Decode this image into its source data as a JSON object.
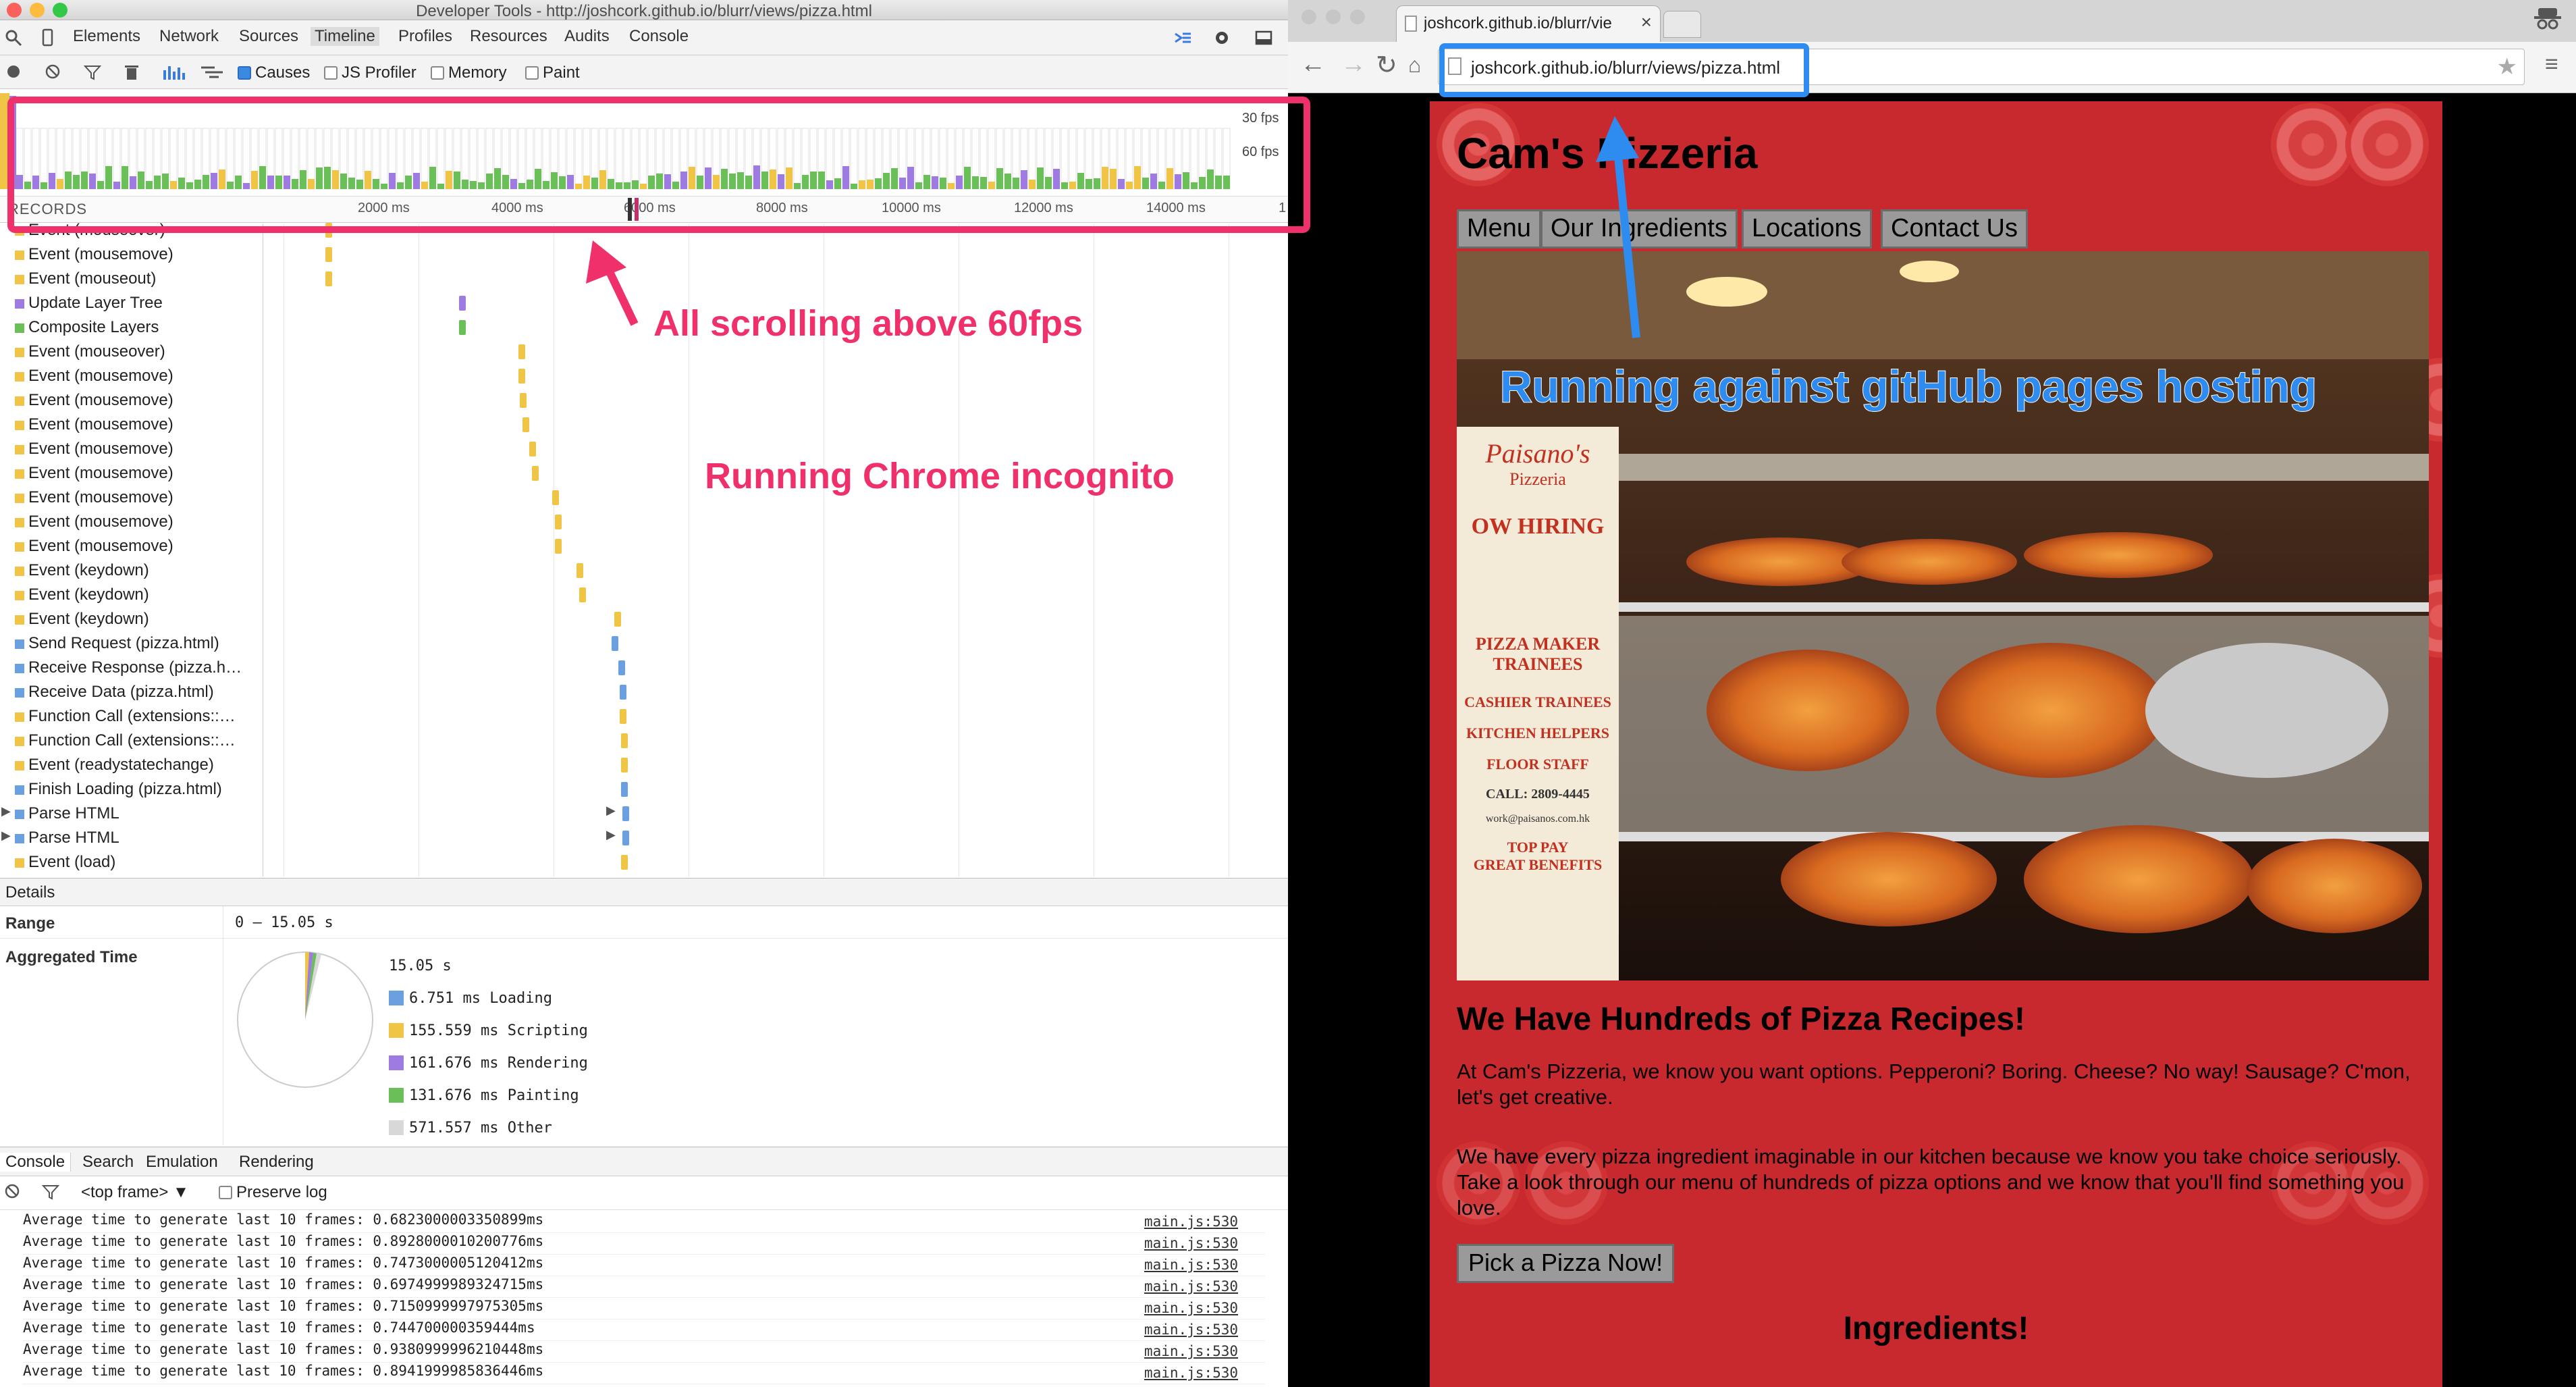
{
  "devtools": {
    "window_title": "Developer Tools - http://joshcork.github.io/blurr/views/pizza.html",
    "tabs": [
      "Elements",
      "Network",
      "Sources",
      "Timeline",
      "Profiles",
      "Resources",
      "Audits",
      "Console"
    ],
    "active_tab": "Timeline",
    "toolbar": {
      "causes": "Causes",
      "js_profiler": "JS Profiler",
      "memory": "Memory",
      "paint": "Paint"
    },
    "fps_30": "30 fps",
    "fps_60": "60 fps",
    "records_label": "RECORDS",
    "axis_ticks": [
      "2000 ms",
      "4000 ms",
      "6000 ms",
      "8000 ms",
      "10000 ms",
      "12000 ms",
      "14000 ms",
      "1"
    ],
    "records": [
      {
        "label": "Event (mouseover)",
        "color": "#f0c444",
        "expandable": false
      },
      {
        "label": "Event (mousemove)",
        "color": "#f0c444",
        "expandable": false
      },
      {
        "label": "Event (mouseout)",
        "color": "#f0c444",
        "expandable": false
      },
      {
        "label": "Update Layer Tree",
        "color": "#9e7be0",
        "expandable": false
      },
      {
        "label": "Composite Layers",
        "color": "#6bbf59",
        "expandable": false
      },
      {
        "label": "Event (mouseover)",
        "color": "#f0c444",
        "expandable": false
      },
      {
        "label": "Event (mousemove)",
        "color": "#f0c444",
        "expandable": false
      },
      {
        "label": "Event (mousemove)",
        "color": "#f0c444",
        "expandable": false
      },
      {
        "label": "Event (mousemove)",
        "color": "#f0c444",
        "expandable": false
      },
      {
        "label": "Event (mousemove)",
        "color": "#f0c444",
        "expandable": false
      },
      {
        "label": "Event (mousemove)",
        "color": "#f0c444",
        "expandable": false
      },
      {
        "label": "Event (mousemove)",
        "color": "#f0c444",
        "expandable": false
      },
      {
        "label": "Event (mousemove)",
        "color": "#f0c444",
        "expandable": false
      },
      {
        "label": "Event (mousemove)",
        "color": "#f0c444",
        "expandable": false
      },
      {
        "label": "Event (keydown)",
        "color": "#f0c444",
        "expandable": false
      },
      {
        "label": "Event (keydown)",
        "color": "#f0c444",
        "expandable": false
      },
      {
        "label": "Event (keydown)",
        "color": "#f0c444",
        "expandable": false
      },
      {
        "label": "Send Request (pizza.html)",
        "color": "#6a9fe0",
        "expandable": false
      },
      {
        "label": "Receive Response (pizza.h…",
        "color": "#6a9fe0",
        "expandable": false
      },
      {
        "label": "Receive Data (pizza.html)",
        "color": "#6a9fe0",
        "expandable": false
      },
      {
        "label": "Function Call (extensions::…",
        "color": "#f0c444",
        "expandable": false
      },
      {
        "label": "Function Call (extensions::…",
        "color": "#f0c444",
        "expandable": false
      },
      {
        "label": "Event (readystatechange)",
        "color": "#f0c444",
        "expandable": false
      },
      {
        "label": "Finish Loading (pizza.html)",
        "color": "#6a9fe0",
        "expandable": false
      },
      {
        "label": "Parse HTML",
        "color": "#6a9fe0",
        "expandable": true
      },
      {
        "label": "Parse HTML",
        "color": "#6a9fe0",
        "expandable": true
      },
      {
        "label": "Event (load)",
        "color": "#f0c444",
        "expandable": false
      }
    ],
    "details": {
      "header": "Details",
      "range_label": "Range",
      "range_value": "0 – 15.05 s",
      "aggregated_label": "Aggregated Time",
      "total": "15.05 s",
      "breakdown": [
        {
          "value": "6.751 ms",
          "label": "Loading",
          "color": "#6a9fe0"
        },
        {
          "value": "155.559 ms",
          "label": "Scripting",
          "color": "#f0c444"
        },
        {
          "value": "161.676 ms",
          "label": "Rendering",
          "color": "#9e7be0"
        },
        {
          "value": "131.676 ms",
          "label": "Painting",
          "color": "#6bbf59"
        },
        {
          "value": "571.557 ms",
          "label": "Other",
          "color": "#d8d8d8"
        }
      ]
    },
    "console": {
      "tabs": [
        "Console",
        "Search",
        "Emulation",
        "Rendering"
      ],
      "frame": "<top frame>",
      "preserve_log": "Preserve log",
      "lines": [
        {
          "text": "Average time to generate last 10 frames: 0.6823000003350899ms",
          "src": "main.js:530"
        },
        {
          "text": "Average time to generate last 10 frames: 0.8928000010200776ms",
          "src": "main.js:530"
        },
        {
          "text": "Average time to generate last 10 frames: 0.7473000005120412ms",
          "src": "main.js:530"
        },
        {
          "text": "Average time to generate last 10 frames: 0.6974999989324715ms",
          "src": "main.js:530"
        },
        {
          "text": "Average time to generate last 10 frames: 0.7150999997975305ms",
          "src": "main.js:530"
        },
        {
          "text": "Average time to generate last 10 frames: 0.744700000359444ms",
          "src": "main.js:530"
        },
        {
          "text": "Average time to generate last 10 frames: 0.9380999996210448ms",
          "src": "main.js:530"
        },
        {
          "text": "Average time to generate last 10 frames: 0.8941999985836446ms",
          "src": "main.js:530"
        }
      ]
    }
  },
  "browser": {
    "tab_title": "joshcork.github.io/blurr/vie",
    "url": "joshcork.github.io/blurr/views/pizza.html",
    "site": {
      "title": "Cam's Pizzeria",
      "nav": [
        "Menu",
        "Our Ingredients",
        "Locations",
        "Contact Us"
      ],
      "heading": "We Have Hundreds of Pizza Recipes!",
      "para1": "At Cam's Pizzeria, we know you want options. Pepperoni? Boring. Cheese? No way! Sausage? C'mon, let's get creative.",
      "para2": "We have every pizza ingredient imaginable in our kitchen because we know you take choice seriously. Take a look through our menu of hundreds of pizza options and we know that you'll find something you love.",
      "cta": "Pick a Pizza Now!",
      "ingredients": "Ingredients!",
      "hero_sign": {
        "brand": "Paisano's",
        "brand_sub": "Pizzeria",
        "hiring": "OW HIRING",
        "lines": [
          "PIZZA MAKER",
          "TRAINEES",
          "CASHIER TRAINEES",
          "KITCHEN HELPERS",
          "FLOOR STAFF",
          "CALL: 2809-4445",
          "work@paisanos.com.hk",
          "TOP PAY",
          "GREAT BENEFITS"
        ]
      }
    }
  },
  "annotations": {
    "scrolling": "All scrolling above 60fps",
    "incognito": "Running Chrome incognito",
    "hosting": "Running against gitHub pages hosting"
  },
  "colors": {
    "annotation_red": "#f0306a",
    "annotation_blue": "#2e8bf0",
    "page_red": "#c8292f"
  }
}
